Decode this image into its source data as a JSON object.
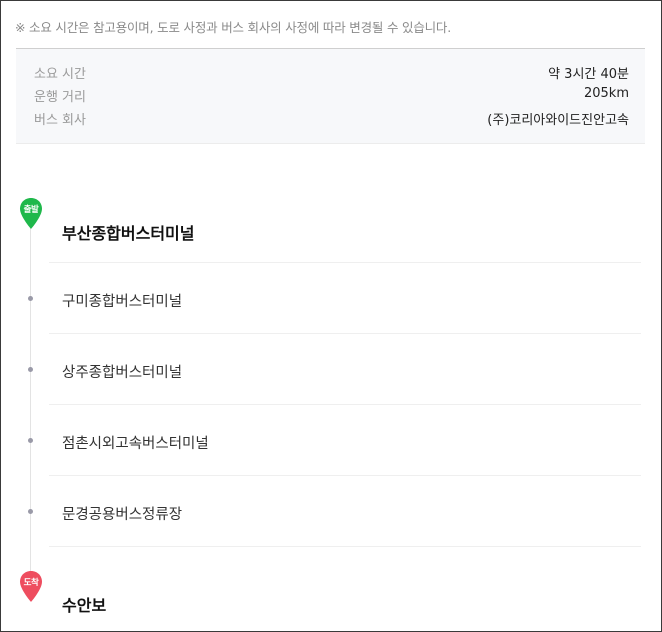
{
  "notice": "※ 소요 시간은 참고용이며, 도로 사정과 버스 회사의 사정에 따라 변경될 수 있습니다.",
  "summary": {
    "rows": [
      {
        "label": "소요 시간",
        "value": "약 3시간 40분"
      },
      {
        "label": "운행 거리",
        "value": "205km"
      },
      {
        "label": "버스 회사",
        "value": "(주)코리아와이드진안고속"
      }
    ]
  },
  "route": {
    "departure": {
      "badge": "출발",
      "name": "부산종합버스터미널",
      "color": "#1fb84b"
    },
    "stops": [
      {
        "name": "구미종합버스터미널"
      },
      {
        "name": "상주종합버스터미널"
      },
      {
        "name": "점촌시외고속버스터미널"
      },
      {
        "name": "문경공용버스정류장"
      }
    ],
    "arrival": {
      "badge": "도착",
      "name": "수안보",
      "color": "#ee4d5f"
    }
  }
}
